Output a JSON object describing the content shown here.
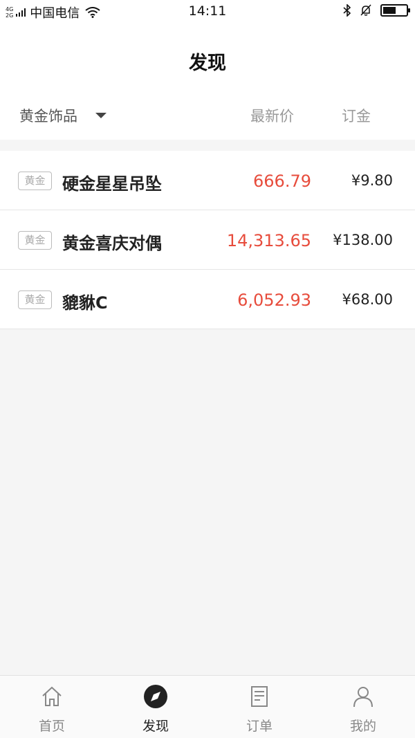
{
  "status_bar": {
    "network_top": "4G",
    "network_bottom": "2G",
    "carrier": "中国电信",
    "time": "14:11",
    "battery_level": 0.55
  },
  "nav": {
    "title": "发现"
  },
  "list_header": {
    "category": "黄金饰品",
    "price_col": "最新价",
    "deposit_col": "订金"
  },
  "products": [
    {
      "tag": "黄金",
      "name": "硬金星星吊坠",
      "price": "666.79",
      "deposit": "¥9.80"
    },
    {
      "tag": "黄金",
      "name": "黄金喜庆对偶",
      "price": "14,313.65",
      "deposit": "¥138.00"
    },
    {
      "tag": "黄金",
      "name": "貔貅C",
      "price": "6,052.93",
      "deposit": "¥68.00"
    }
  ],
  "tabs": [
    {
      "label": "首页",
      "icon": "home-icon",
      "active": false
    },
    {
      "label": "发现",
      "icon": "compass-icon",
      "active": true
    },
    {
      "label": "订单",
      "icon": "order-list-icon",
      "active": false
    },
    {
      "label": "我的",
      "icon": "user-icon",
      "active": false
    }
  ],
  "colors": {
    "price_red": "#e74c3c",
    "accent_dark": "#222222"
  }
}
